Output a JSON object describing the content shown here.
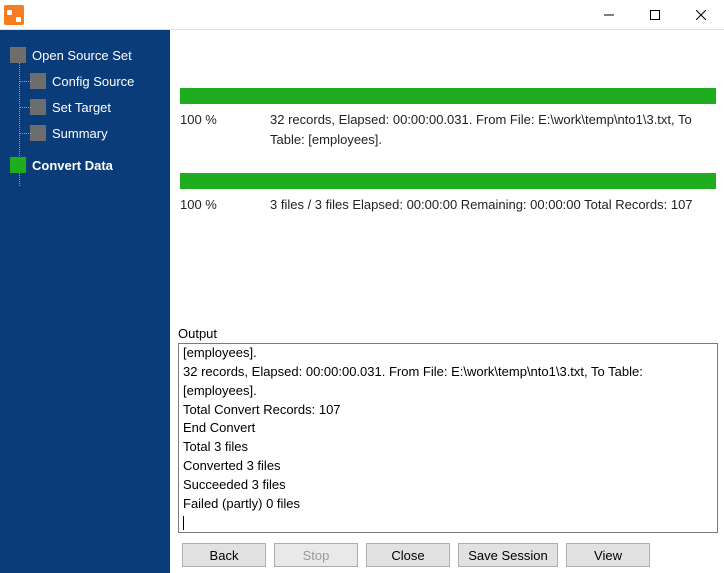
{
  "sidebar": {
    "items": [
      {
        "label": "Open Source Set"
      },
      {
        "label": "Config Source"
      },
      {
        "label": "Set Target"
      },
      {
        "label": "Summary"
      },
      {
        "label": "Convert Data"
      }
    ]
  },
  "progress": {
    "file": {
      "percent": "100 %",
      "details": "32 records,    Elapsed: 00:00:00.031.    From File: E:\\work\\temp\\nto1\\3.txt,  To Table: [employees]."
    },
    "total": {
      "percent": "100 %",
      "details": "3 files / 3 files    Elapsed: 00:00:00    Remaining: 00:00:00    Total Records: 107"
    }
  },
  "output": {
    "label": "Output",
    "lines": [
      "[employees].",
      "32 records,    Elapsed: 00:00:00.031.    From File: E:\\work\\temp\\nto1\\3.txt,    To Table: [employees].",
      "Total Convert Records: 107",
      "End Convert",
      "Total 3 files",
      "Converted 3 files",
      "Succeeded 3 files",
      "Failed (partly) 0 files"
    ]
  },
  "buttons": {
    "back": "Back",
    "stop": "Stop",
    "close": "Close",
    "save_session": "Save Session",
    "view": "View"
  }
}
